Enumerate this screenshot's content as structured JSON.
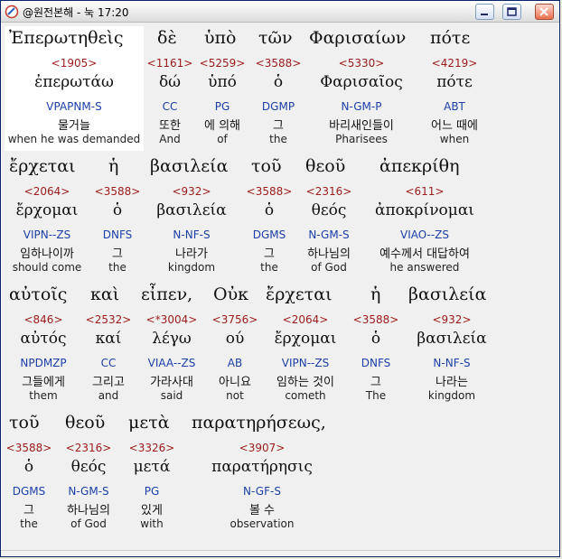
{
  "window": {
    "title": "@원전본해 - 눅 17:20"
  },
  "rows": [
    {
      "greek_line": [
        "Ἐπερωτηθεὶς",
        "δὲ",
        "ὑπὸ",
        "τῶν",
        "Φαρισαίων",
        "πότε"
      ],
      "words": [
        {
          "strong": "<1905>",
          "lemma": "ἐπερωτάω",
          "morph": "VPAPNM-S",
          "korean": "물거늘",
          "english": "when he was demanded"
        },
        {
          "strong": "<1161>",
          "lemma": "δώ",
          "morph": "CC",
          "korean": "또한",
          "english": "And"
        },
        {
          "strong": "<5259>",
          "lemma": "ὑπό",
          "morph": "PG",
          "korean": "에 의해",
          "english": "of"
        },
        {
          "strong": "<3588>",
          "lemma": "ὁ",
          "morph": "DGMP",
          "korean": "그",
          "english": "the"
        },
        {
          "strong": "<5330>",
          "lemma": "Φαρισαῖος",
          "morph": "N-GM-P",
          "korean": "바리새인들이",
          "english": "Pharisees"
        },
        {
          "strong": "<4219>",
          "lemma": "πότε",
          "morph": "ABT",
          "korean": "어느 때에",
          "english": "when"
        }
      ]
    },
    {
      "greek_line": [
        "ἔρχεται",
        "ἡ",
        "βασιλεία",
        "τοῦ",
        "θεοῦ",
        "ἀπεκρίθη"
      ],
      "words": [
        {
          "strong": "<2064>",
          "lemma": "ἔρχομαι",
          "morph": "VIPN--ZS",
          "korean": "임하나이까",
          "english": "should come"
        },
        {
          "strong": "<3588>",
          "lemma": "ὁ",
          "morph": "DNFS",
          "korean": "그",
          "english": "the"
        },
        {
          "strong": "<932>",
          "lemma": "βασιλεία",
          "morph": "N-NF-S",
          "korean": "나라가",
          "english": "kingdom"
        },
        {
          "strong": "<3588>",
          "lemma": "ὁ",
          "morph": "DGMS",
          "korean": "그",
          "english": "the"
        },
        {
          "strong": "<2316>",
          "lemma": "θεός",
          "morph": "N-GM-S",
          "korean": "하나님의",
          "english": "of God"
        },
        {
          "strong": "<611>",
          "lemma": "ἀποκρίνομαι",
          "morph": "VIAO--ZS",
          "korean": "예수께서 대답하여",
          "english": "he answered"
        }
      ]
    },
    {
      "greek_line": [
        "αὐτοῖς",
        "καὶ",
        "εἶπεν,",
        "Οὐκ",
        "ἔρχεται",
        "ἡ",
        "βασιλεία"
      ],
      "words": [
        {
          "strong": "<846>",
          "lemma": "αὐτός",
          "morph": "NPDMZP",
          "korean": "그들에게",
          "english": "them"
        },
        {
          "strong": "<2532>",
          "lemma": "καί",
          "morph": "CC",
          "korean": "그리고",
          "english": "and"
        },
        {
          "strong": "<*3004>",
          "lemma": "λέγω",
          "morph": "VIAA--ZS",
          "korean": "가라사대",
          "english": "said"
        },
        {
          "strong": "<3756>",
          "lemma": "ού",
          "morph": "AB",
          "korean": "아니요",
          "english": "not"
        },
        {
          "strong": "<2064>",
          "lemma": "ἔρχομαι",
          "morph": "VIPN--ZS",
          "korean": "임하는 것이",
          "english": "cometh"
        },
        {
          "strong": "<3588>",
          "lemma": "ὁ",
          "morph": "DNFS",
          "korean": "그",
          "english": "The"
        },
        {
          "strong": "<932>",
          "lemma": "βασιλεία",
          "morph": "N-NF-S",
          "korean": "나라는",
          "english": "kingdom"
        }
      ]
    },
    {
      "greek_line": [
        "τοῦ",
        "θεοῦ",
        "μετὰ",
        "παρατηρήσεως,"
      ],
      "words": [
        {
          "strong": "<3588>",
          "lemma": "ὁ",
          "morph": "DGMS",
          "korean": "그",
          "english": "the"
        },
        {
          "strong": "<2316>",
          "lemma": "θεός",
          "morph": "N-GM-S",
          "korean": "하나님의",
          "english": "of God"
        },
        {
          "strong": "<3326>",
          "lemma": "μετά",
          "morph": "PG",
          "korean": "있게",
          "english": "with"
        },
        {
          "strong": "<3907>",
          "lemma": "παρατήρησις",
          "morph": "N-GF-S",
          "korean": "볼 수",
          "english": "observation"
        }
      ]
    }
  ]
}
